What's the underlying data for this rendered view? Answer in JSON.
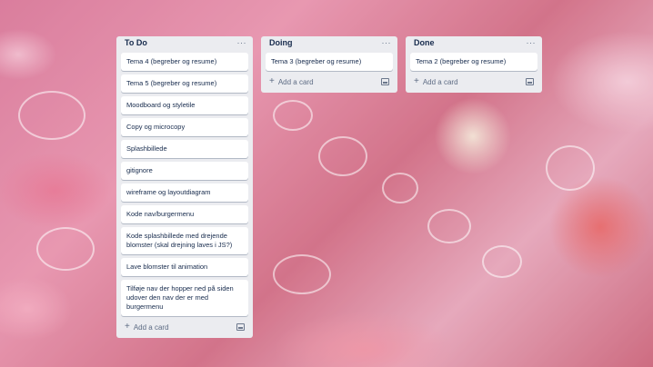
{
  "colors": {
    "list_bg": "#ebecf0",
    "card_bg": "#ffffff",
    "text": "#172b4d",
    "muted": "#5e6c84"
  },
  "lists": [
    {
      "title": "To Do",
      "menu_icon": "more-horizontal-icon",
      "cards": [
        "Tema 4 (begreber og resume)",
        "Tema 5 (begreber og resume)",
        "Moodboard og styletile",
        "Copy og microcopy",
        "Splashbillede",
        "gitignore",
        "wireframe og layoutdiagram",
        "Kode nav/burgermenu",
        "Kode splashbillede med drejende blomster (skal drejning laves i JS?)",
        "Lave blomster til animation",
        "Tilføje nav der hopper ned på siden udover den nav der er med burgermenu"
      ],
      "add_label": "Add a card"
    },
    {
      "title": "Doing",
      "menu_icon": "more-horizontal-icon",
      "cards": [
        "Tema 3 (begreber og resume)"
      ],
      "add_label": "Add a card"
    },
    {
      "title": "Done",
      "menu_icon": "more-horizontal-icon",
      "cards": [
        "Tema 2 (begreber og resume)"
      ],
      "add_label": "Add a card"
    }
  ],
  "menu_glyph": "···",
  "plus_glyph": "+"
}
